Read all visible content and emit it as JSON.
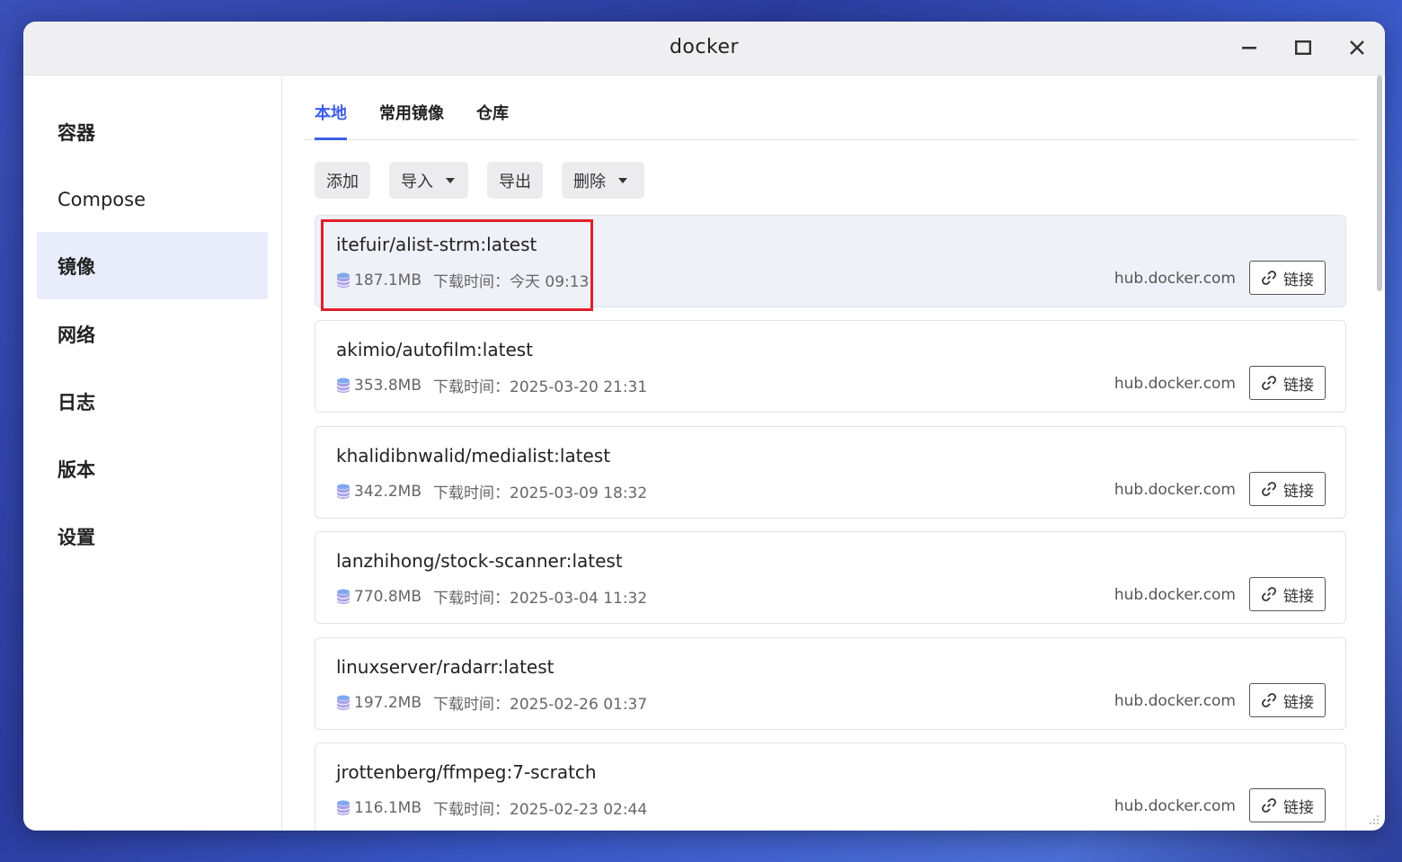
{
  "window": {
    "title": "docker"
  },
  "sidebar": {
    "items": [
      {
        "label": "容器"
      },
      {
        "label": "Compose"
      },
      {
        "label": "镜像"
      },
      {
        "label": "网络"
      },
      {
        "label": "日志"
      },
      {
        "label": "版本"
      },
      {
        "label": "设置"
      }
    ],
    "active": "镜像"
  },
  "tabs": [
    {
      "label": "本地"
    },
    {
      "label": "常用镜像"
    },
    {
      "label": "仓库"
    }
  ],
  "toolbar": {
    "add": "添加",
    "import": "导入",
    "export": "导出",
    "delete": "删除"
  },
  "images": [
    {
      "name": "itefuir/alist-strm:latest",
      "size": "187.1MB",
      "time": "下载时间：今天 09:13",
      "registry": "hub.docker.com",
      "link": "链接"
    },
    {
      "name": "akimio/autofilm:latest",
      "size": "353.8MB",
      "time": "下载时间：2025-03-20 21:31",
      "registry": "hub.docker.com",
      "link": "链接"
    },
    {
      "name": "khalidibnwalid/medialist:latest",
      "size": "342.2MB",
      "time": "下载时间：2025-03-09 18:32",
      "registry": "hub.docker.com",
      "link": "链接"
    },
    {
      "name": "lanzhihong/stock-scanner:latest",
      "size": "770.8MB",
      "time": "下载时间：2025-03-04 11:32",
      "registry": "hub.docker.com",
      "link": "链接"
    },
    {
      "name": "linuxserver/radarr:latest",
      "size": "197.2MB",
      "time": "下载时间：2025-02-26 01:37",
      "registry": "hub.docker.com",
      "link": "链接"
    },
    {
      "name": "jrottenberg/ffmpeg:7-scratch",
      "size": "116.1MB",
      "time": "下载时间：2025-02-23 02:44",
      "registry": "hub.docker.com",
      "link": "链接"
    }
  ],
  "colors": {
    "accent": "#3c5ee8",
    "highlight": "#e0202b",
    "active_nav_bg": "#e9ecfb"
  },
  "icons": {
    "window_controls": [
      "minimize-icon",
      "maximize-icon",
      "close-icon"
    ],
    "size": "database-icon",
    "link": "link-icon"
  }
}
